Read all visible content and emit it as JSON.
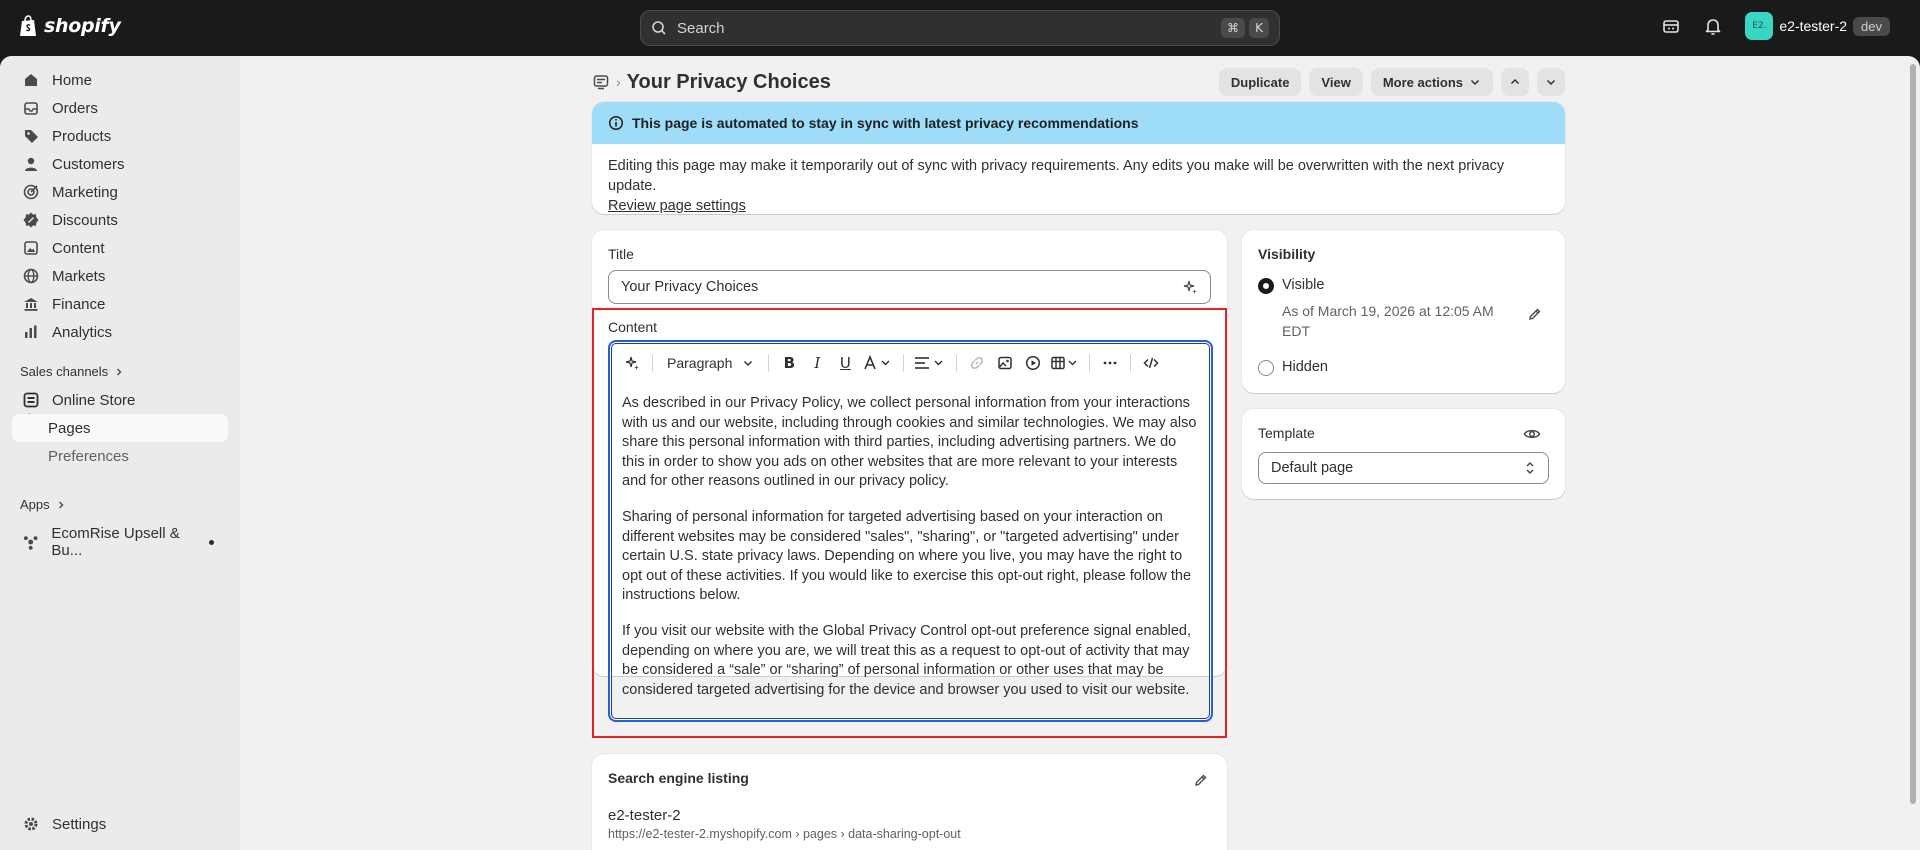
{
  "app": {
    "logo_text": "shopify",
    "search_placeholder": "Search",
    "kbd_cmd": "⌘",
    "kbd_k": "K",
    "user_initials": "E2.",
    "user_name": "e2-tester-2",
    "env_badge": "dev"
  },
  "sidebar": {
    "items": [
      {
        "label": "Home",
        "icon": "home-icon"
      },
      {
        "label": "Orders",
        "icon": "orders-icon"
      },
      {
        "label": "Products",
        "icon": "tag-icon"
      },
      {
        "label": "Customers",
        "icon": "person-icon"
      },
      {
        "label": "Marketing",
        "icon": "target-icon"
      },
      {
        "label": "Discounts",
        "icon": "discount-icon"
      },
      {
        "label": "Content",
        "icon": "content-icon"
      },
      {
        "label": "Markets",
        "icon": "globe-icon"
      },
      {
        "label": "Finance",
        "icon": "bank-icon"
      },
      {
        "label": "Analytics",
        "icon": "chart-icon"
      }
    ],
    "sales_channels_label": "Sales channels",
    "online_store": "Online Store",
    "pages": "Pages",
    "preferences": "Preferences",
    "apps_label": "Apps",
    "app_item": "EcomRise Upsell & Bu...",
    "settings": "Settings"
  },
  "header": {
    "title": "Your Privacy Choices",
    "duplicate": "Duplicate",
    "view": "View",
    "more_actions": "More actions"
  },
  "banner": {
    "heading": "This page is automated to stay in sync with latest privacy recommendations",
    "body": "Editing this page may make it temporarily out of sync with privacy requirements. Any edits you make will be overwritten with the next privacy update.",
    "link": "Review page settings"
  },
  "form": {
    "title_label": "Title",
    "title_value": "Your Privacy Choices",
    "content_label": "Content",
    "paragraph_select": "Paragraph",
    "paragraphs": [
      "As described in our Privacy Policy, we collect personal information from your interactions with us and our website, including through cookies and similar technologies. We may also share this personal information with third parties, including advertising partners. We do this in order to show you ads on other websites that are more relevant to your interests and for other reasons outlined in our privacy policy.",
      "Sharing of personal information for targeted advertising based on your interaction on different websites may be considered \"sales\", \"sharing\", or \"targeted advertising\" under certain U.S. state privacy laws. Depending on where you live, you may have the right to opt out of these activities. If you would like to exercise this opt-out right, please follow the instructions below.",
      "If you visit our website with the Global Privacy Control opt-out preference signal enabled, depending on where you are, we will treat this as a request to opt-out of activity that may be considered a “sale” or “sharing” of personal information or other uses that may be considered targeted advertising for the device and browser you used to visit our website."
    ]
  },
  "seo": {
    "title": "Search engine listing",
    "name": "e2-tester-2",
    "url": "https://e2-tester-2.myshopify.com › pages › data-sharing-opt-out"
  },
  "visibility": {
    "title": "Visibility",
    "visible_label": "Visible",
    "visible_sub": "As of March 19, 2026 at 12:05 AM EDT",
    "hidden_label": "Hidden",
    "selected": "Visible"
  },
  "template": {
    "title": "Template",
    "value": "Default page"
  },
  "colors": {
    "accent_banner": "#9fdcf8",
    "focus_border": "#2a5fd0",
    "highlight": "#e02424",
    "avatar": "#39d5c5"
  }
}
